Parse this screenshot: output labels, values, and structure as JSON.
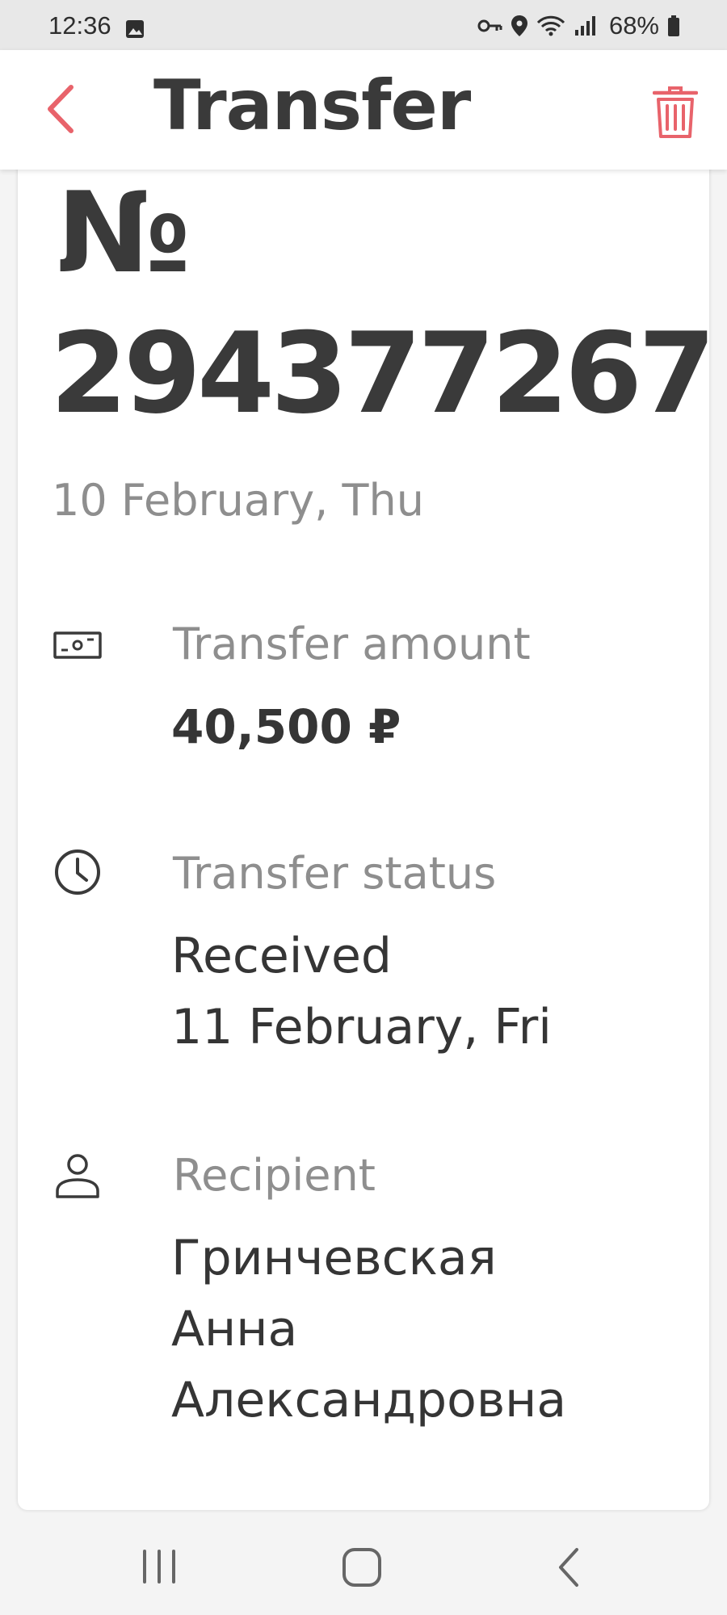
{
  "status_bar": {
    "time": "12:36",
    "battery": "68%",
    "icons": [
      "gallery-icon",
      "key-icon",
      "location-icon",
      "wifi-icon",
      "signal-icon",
      "battery-icon"
    ]
  },
  "header": {
    "title": "Transfer",
    "back_icon": "chevron-left-icon",
    "delete_icon": "trash-icon"
  },
  "transfer": {
    "number_prefix": "№",
    "number": "294377267",
    "date": "10 February, Thu"
  },
  "details": {
    "amount": {
      "icon": "banknote-icon",
      "label": "Transfer amount",
      "value": "40,500 ₽"
    },
    "status": {
      "icon": "clock-icon",
      "label": "Transfer status",
      "value_line1": "Received",
      "value_line2": "11 February, Fri"
    },
    "recipient": {
      "icon": "person-icon",
      "label": "Recipient",
      "name_line1": "Гринчевская",
      "name_line2": "Анна",
      "name_line3": "Александровна"
    }
  },
  "nav": {
    "icons": [
      "recent-apps-icon",
      "home-icon",
      "back-icon"
    ]
  },
  "colors": {
    "accent": "#e8636b",
    "text": "#3a3a3a",
    "muted": "#8e8e8e",
    "background": "#f4f4f4"
  }
}
